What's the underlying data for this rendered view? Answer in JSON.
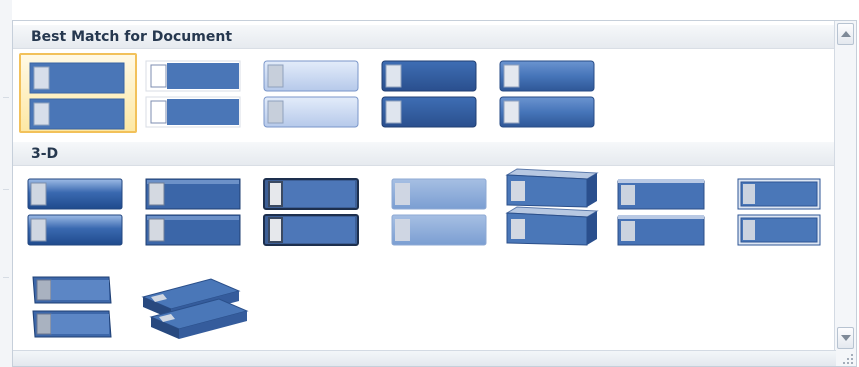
{
  "gallery": {
    "groups": [
      {
        "label": "Best Match for Document",
        "style_count": 5,
        "selected_index": 0
      },
      {
        "label": "3-D",
        "style_count": 9
      }
    ]
  },
  "icons": {
    "scroll_up": "chevron-up-icon",
    "scroll_down": "chevron-down-icon",
    "resize": "resize-grip-icon"
  },
  "colors": {
    "accent_blue": "#4a76b7",
    "dark_blue": "#2f5797",
    "light_blue": "#c9daf3",
    "selection_border": "#f2c15a",
    "header_text": "#26384f"
  }
}
